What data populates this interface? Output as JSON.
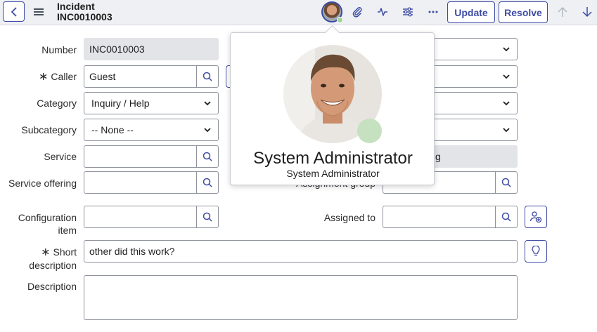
{
  "header": {
    "record_type": "Incident",
    "record_number": "INC0010003",
    "update_label": "Update",
    "resolve_label": "Resolve",
    "icons": [
      "chevron-left-icon",
      "hamburger-menu-icon",
      "user-avatar",
      "paperclip-icon",
      "activity-icon",
      "sliders-icon",
      "more-icon",
      "arrow-up-icon",
      "arrow-down-icon"
    ]
  },
  "form": {
    "number": {
      "label": "Number",
      "value": "INC0010003"
    },
    "caller": {
      "label": "Caller",
      "value": "Guest",
      "required_mark": "∗"
    },
    "category": {
      "label": "Category",
      "value": "Inquiry / Help"
    },
    "subcategory": {
      "label": "Subcategory",
      "value": "-- None --"
    },
    "service": {
      "label": "Service",
      "value": ""
    },
    "service_offering": {
      "label": "Service offering",
      "value": ""
    },
    "configuration_item": {
      "label": "Configuration item",
      "value": ""
    },
    "assignment_group": {
      "label": "Assignment group",
      "value": ""
    },
    "assigned_to": {
      "label": "Assigned to",
      "value": ""
    },
    "short_description": {
      "label": "Short description",
      "value": "other did this work?",
      "required_mark": "∗"
    },
    "description": {
      "label": "Description",
      "value": ""
    },
    "right_readonly_fragment": "g"
  },
  "popover": {
    "name": "System Administrator",
    "title": "System Administrator",
    "presence_color": "#c6e1c0"
  },
  "colors": {
    "accent": "#3d4ba4",
    "header_bg": "#eef0f4",
    "readonly_bg": "#e3e4e8"
  }
}
